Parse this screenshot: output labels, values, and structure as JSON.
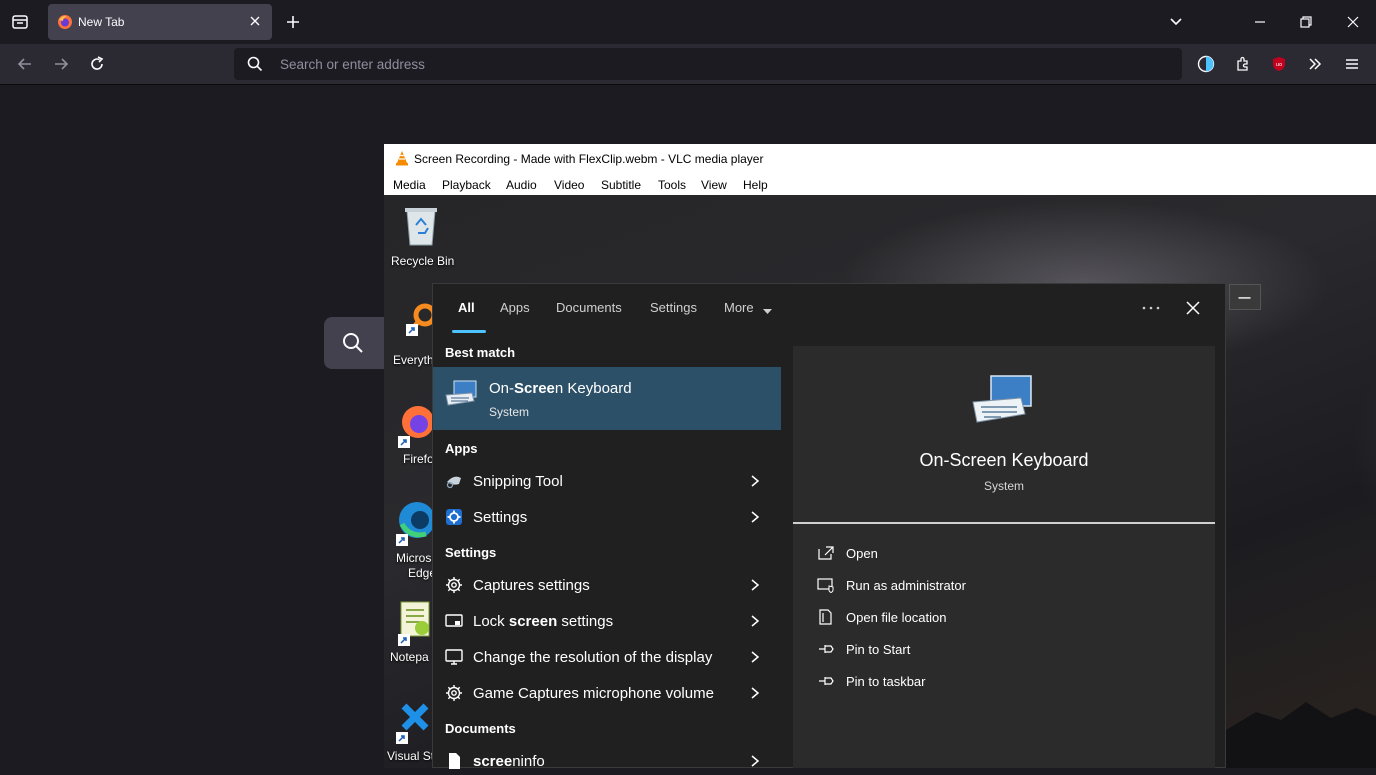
{
  "browser": {
    "tab_title": "New Tab",
    "address_placeholder": "Search or enter address"
  },
  "vlc": {
    "title": "Screen Recording - Made with FlexClip.webm - VLC media player",
    "menu": [
      "Media",
      "Playback",
      "Audio",
      "Video",
      "Subtitle",
      "Tools",
      "View",
      "Help"
    ]
  },
  "desktop": {
    "icons": [
      "Recycle Bin",
      "Everyth",
      "Firefo",
      "Micros",
      "Edge",
      "Notepa",
      "Visual St"
    ]
  },
  "search": {
    "tabs": [
      "All",
      "Apps",
      "Documents",
      "Settings",
      "More"
    ],
    "sections": {
      "best_match": "Best match",
      "apps": "Apps",
      "settings": "Settings",
      "documents": "Documents"
    },
    "best_match": {
      "title_prefix": "On-",
      "title_bold": "Scree",
      "title_suffix": "n Keyboard",
      "subtitle": "System"
    },
    "apps": [
      "Snipping Tool",
      "Settings"
    ],
    "settings_items": [
      {
        "prefix": "Captures settings",
        "bold": "",
        "suffix": ""
      },
      {
        "prefix": "Lock ",
        "bold": "screen",
        "suffix": " settings"
      },
      {
        "prefix": "Change the resolution of the display",
        "bold": "",
        "suffix": ""
      },
      {
        "prefix": "Game Captures microphone volume",
        "bold": "",
        "suffix": ""
      }
    ],
    "document_item": {
      "prefix": "",
      "bold": "scree",
      "suffix": "ninfo"
    },
    "detail": {
      "title": "On-Screen Keyboard",
      "subtitle": "System",
      "actions": [
        "Open",
        "Run as administrator",
        "Open file location",
        "Pin to Start",
        "Pin to taskbar"
      ]
    }
  },
  "colors": {
    "accent": "#2c5068",
    "tab_underline": "#4cc2ff",
    "panel_bg": "#202020",
    "vlc_orange": "#f48b00",
    "ublock_red": "#c4001f"
  }
}
